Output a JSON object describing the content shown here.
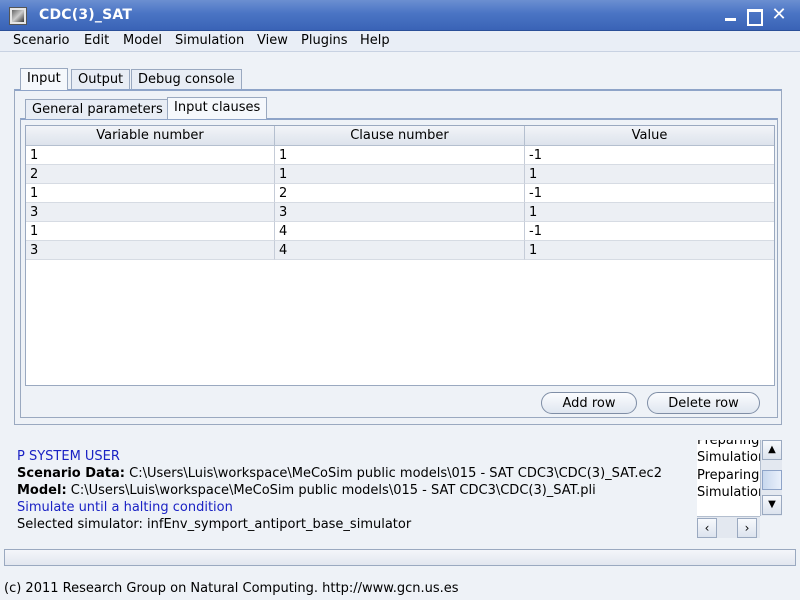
{
  "window": {
    "title": "CDC(3)_SAT"
  },
  "menu": [
    "Scenario",
    "Edit",
    "Model",
    "Simulation",
    "View",
    "Plugins",
    "Help"
  ],
  "outer_tabs": [
    "Input",
    "Output",
    "Debug console"
  ],
  "inner_tabs": [
    "General parameters",
    "Input clauses"
  ],
  "table": {
    "columns": [
      "Variable number",
      "Clause number",
      "Value"
    ],
    "rows": [
      [
        "1",
        "1",
        "-1"
      ],
      [
        "2",
        "1",
        "1"
      ],
      [
        "1",
        "2",
        "-1"
      ],
      [
        "3",
        "3",
        "1"
      ],
      [
        "1",
        "4",
        "-1"
      ],
      [
        "3",
        "4",
        "1"
      ]
    ]
  },
  "buttons": {
    "add_row": "Add row",
    "delete_row": "Delete row"
  },
  "log": {
    "user": "P SYSTEM USER",
    "scenario_label": "Scenario Data:",
    "scenario_path": "C:\\Users\\Luis\\workspace\\MeCoSim public models\\015 - SAT CDC3\\CDC(3)_SAT.ec2",
    "model_label": "Model:",
    "model_path": "C:\\Users\\Luis\\workspace\\MeCoSim public models\\015 - SAT CDC3\\CDC(3)_SAT.pli",
    "halt": "Simulate until a halting condition",
    "simulator": "Selected simulator: infEnv_symport_antiport_base_simulator"
  },
  "mini_log": [
    "Preparing",
    "Simulation",
    "Preparing",
    "Simulation"
  ],
  "status": "(c) 2011 Research Group on Natural Computing. http://www.gcn.us.es"
}
